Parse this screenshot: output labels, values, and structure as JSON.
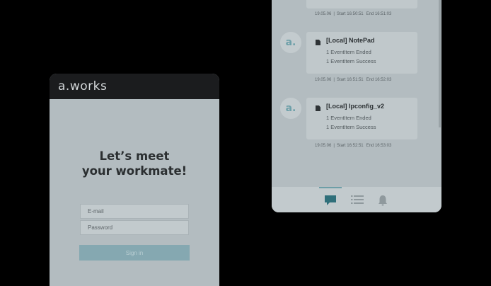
{
  "login": {
    "brand": "a.works",
    "headline_line1": "Let’s meet",
    "headline_line2": "your workmate!",
    "email_placeholder": "E-mail",
    "password_placeholder": "Password",
    "signin_label": "Sign in"
  },
  "feed": {
    "top_meta": {
      "date": "19.05.06",
      "start": "Start 16:50:51",
      "end": "End 16:51:03"
    },
    "events": [
      {
        "avatar": "a.",
        "title": "[Local] NotePad",
        "line1": "1 EventItem Ended",
        "line2": "1 EventItem Success",
        "date": "19.05.06",
        "start": "Start 16:51:51",
        "end": "End 16:52:03"
      },
      {
        "avatar": "a.",
        "title": "[Local] Ipconfig_v2",
        "line1": "1 EventItem Ended",
        "line2": "1 EventItem Success",
        "date": "19.05.06",
        "start": "Start 16:52:51",
        "end": "End 16:53:03"
      }
    ],
    "nav": [
      "chat-icon",
      "list-icon",
      "bell-icon"
    ]
  },
  "colors": {
    "background": "#000000",
    "screen": "#b3bcc0",
    "header": "#1b1c1e",
    "accent": "#6d9ea7",
    "signin_button": "#85a8b1"
  }
}
